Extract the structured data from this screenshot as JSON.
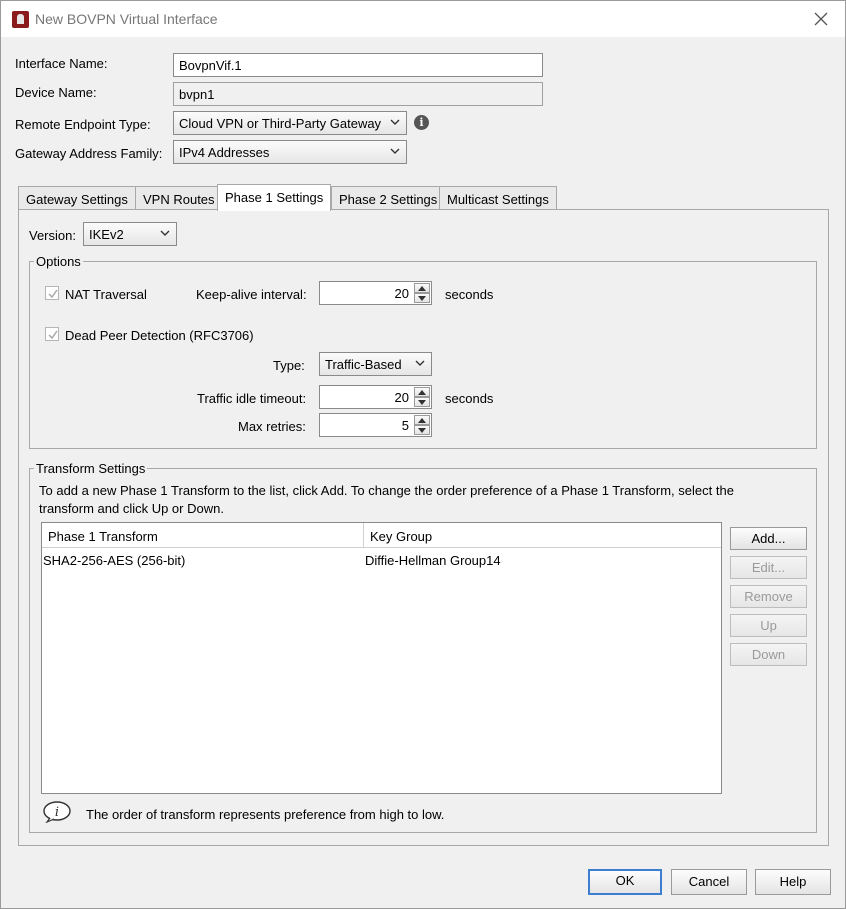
{
  "window": {
    "title": "New BOVPN Virtual Interface"
  },
  "form": {
    "interface_name_label": "Interface Name:",
    "interface_name_value": "BovpnVif.1",
    "device_name_label": "Device Name:",
    "device_name_value": "bvpn1",
    "remote_endpoint_label": "Remote Endpoint Type:",
    "remote_endpoint_value": "Cloud VPN or Third-Party Gateway",
    "gateway_family_label": "Gateway Address Family:",
    "gateway_family_value": "IPv4 Addresses"
  },
  "tabs": [
    {
      "label": "Gateway Settings"
    },
    {
      "label": "VPN Routes"
    },
    {
      "label": "Phase 1 Settings",
      "active": true
    },
    {
      "label": "Phase 2 Settings"
    },
    {
      "label": "Multicast Settings"
    }
  ],
  "phase1": {
    "version_label": "Version:",
    "version_value": "IKEv2",
    "options_title": "Options",
    "nat_traversal_label": "NAT Traversal",
    "keepalive_label": "Keep-alive interval:",
    "keepalive_value": "20",
    "keepalive_unit": "seconds",
    "dpd_label": "Dead Peer Detection (RFC3706)",
    "type_label": "Type:",
    "type_value": "Traffic-Based",
    "idle_timeout_label": "Traffic idle timeout:",
    "idle_timeout_value": "20",
    "idle_timeout_unit": "seconds",
    "max_retries_label": "Max retries:",
    "max_retries_value": "5"
  },
  "transform": {
    "title": "Transform Settings",
    "instructions_line1": "To add a new Phase 1 Transform to the list, click Add. To change the order preference of a Phase 1 Transform, select the",
    "instructions_line2": "transform and click Up or Down.",
    "columns": [
      "Phase 1 Transform",
      "Key Group"
    ],
    "rows": [
      [
        "SHA2-256-AES (256-bit)",
        "Diffie-Hellman Group14"
      ]
    ],
    "buttons": {
      "add": "Add...",
      "edit": "Edit...",
      "remove": "Remove",
      "up": "Up",
      "down": "Down"
    },
    "note": "The order of transform represents preference from high to low."
  },
  "footer": {
    "ok": "OK",
    "cancel": "Cancel",
    "help": "Help"
  }
}
